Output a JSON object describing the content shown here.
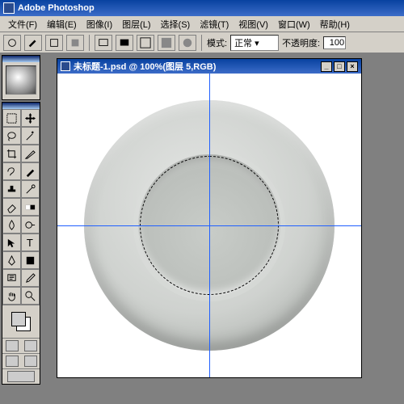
{
  "app": {
    "title": "Adobe Photoshop"
  },
  "menu": {
    "file": "文件(F)",
    "edit": "编辑(E)",
    "image": "图像(I)",
    "layer": "图层(L)",
    "select": "选择(S)",
    "filter": "滤镜(T)",
    "view": "视图(V)",
    "window": "窗口(W)",
    "help": "帮助(H)"
  },
  "options": {
    "mode_label": "模式:",
    "mode_value": "正常",
    "opacity_label": "不透明度:",
    "opacity_value": "100"
  },
  "document": {
    "title": "未标题-1.psd @ 100%(图层 5,RGB)"
  },
  "window_controls": {
    "min": "_",
    "max": "□",
    "close": "×"
  },
  "colors": {
    "guide": "#2060ff",
    "ui_bg": "#d4d0c8"
  }
}
